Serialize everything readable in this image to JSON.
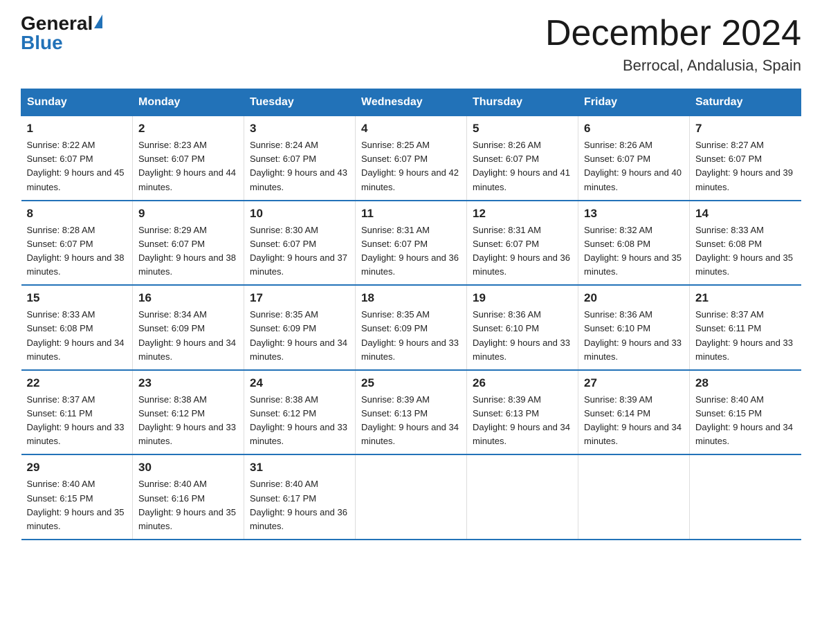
{
  "header": {
    "logo_general": "General",
    "logo_blue": "Blue",
    "month_title": "December 2024",
    "location": "Berrocal, Andalusia, Spain"
  },
  "days_of_week": [
    "Sunday",
    "Monday",
    "Tuesday",
    "Wednesday",
    "Thursday",
    "Friday",
    "Saturday"
  ],
  "weeks": [
    [
      {
        "day": "1",
        "sunrise": "Sunrise: 8:22 AM",
        "sunset": "Sunset: 6:07 PM",
        "daylight": "Daylight: 9 hours and 45 minutes."
      },
      {
        "day": "2",
        "sunrise": "Sunrise: 8:23 AM",
        "sunset": "Sunset: 6:07 PM",
        "daylight": "Daylight: 9 hours and 44 minutes."
      },
      {
        "day": "3",
        "sunrise": "Sunrise: 8:24 AM",
        "sunset": "Sunset: 6:07 PM",
        "daylight": "Daylight: 9 hours and 43 minutes."
      },
      {
        "day": "4",
        "sunrise": "Sunrise: 8:25 AM",
        "sunset": "Sunset: 6:07 PM",
        "daylight": "Daylight: 9 hours and 42 minutes."
      },
      {
        "day": "5",
        "sunrise": "Sunrise: 8:26 AM",
        "sunset": "Sunset: 6:07 PM",
        "daylight": "Daylight: 9 hours and 41 minutes."
      },
      {
        "day": "6",
        "sunrise": "Sunrise: 8:26 AM",
        "sunset": "Sunset: 6:07 PM",
        "daylight": "Daylight: 9 hours and 40 minutes."
      },
      {
        "day": "7",
        "sunrise": "Sunrise: 8:27 AM",
        "sunset": "Sunset: 6:07 PM",
        "daylight": "Daylight: 9 hours and 39 minutes."
      }
    ],
    [
      {
        "day": "8",
        "sunrise": "Sunrise: 8:28 AM",
        "sunset": "Sunset: 6:07 PM",
        "daylight": "Daylight: 9 hours and 38 minutes."
      },
      {
        "day": "9",
        "sunrise": "Sunrise: 8:29 AM",
        "sunset": "Sunset: 6:07 PM",
        "daylight": "Daylight: 9 hours and 38 minutes."
      },
      {
        "day": "10",
        "sunrise": "Sunrise: 8:30 AM",
        "sunset": "Sunset: 6:07 PM",
        "daylight": "Daylight: 9 hours and 37 minutes."
      },
      {
        "day": "11",
        "sunrise": "Sunrise: 8:31 AM",
        "sunset": "Sunset: 6:07 PM",
        "daylight": "Daylight: 9 hours and 36 minutes."
      },
      {
        "day": "12",
        "sunrise": "Sunrise: 8:31 AM",
        "sunset": "Sunset: 6:07 PM",
        "daylight": "Daylight: 9 hours and 36 minutes."
      },
      {
        "day": "13",
        "sunrise": "Sunrise: 8:32 AM",
        "sunset": "Sunset: 6:08 PM",
        "daylight": "Daylight: 9 hours and 35 minutes."
      },
      {
        "day": "14",
        "sunrise": "Sunrise: 8:33 AM",
        "sunset": "Sunset: 6:08 PM",
        "daylight": "Daylight: 9 hours and 35 minutes."
      }
    ],
    [
      {
        "day": "15",
        "sunrise": "Sunrise: 8:33 AM",
        "sunset": "Sunset: 6:08 PM",
        "daylight": "Daylight: 9 hours and 34 minutes."
      },
      {
        "day": "16",
        "sunrise": "Sunrise: 8:34 AM",
        "sunset": "Sunset: 6:09 PM",
        "daylight": "Daylight: 9 hours and 34 minutes."
      },
      {
        "day": "17",
        "sunrise": "Sunrise: 8:35 AM",
        "sunset": "Sunset: 6:09 PM",
        "daylight": "Daylight: 9 hours and 34 minutes."
      },
      {
        "day": "18",
        "sunrise": "Sunrise: 8:35 AM",
        "sunset": "Sunset: 6:09 PM",
        "daylight": "Daylight: 9 hours and 33 minutes."
      },
      {
        "day": "19",
        "sunrise": "Sunrise: 8:36 AM",
        "sunset": "Sunset: 6:10 PM",
        "daylight": "Daylight: 9 hours and 33 minutes."
      },
      {
        "day": "20",
        "sunrise": "Sunrise: 8:36 AM",
        "sunset": "Sunset: 6:10 PM",
        "daylight": "Daylight: 9 hours and 33 minutes."
      },
      {
        "day": "21",
        "sunrise": "Sunrise: 8:37 AM",
        "sunset": "Sunset: 6:11 PM",
        "daylight": "Daylight: 9 hours and 33 minutes."
      }
    ],
    [
      {
        "day": "22",
        "sunrise": "Sunrise: 8:37 AM",
        "sunset": "Sunset: 6:11 PM",
        "daylight": "Daylight: 9 hours and 33 minutes."
      },
      {
        "day": "23",
        "sunrise": "Sunrise: 8:38 AM",
        "sunset": "Sunset: 6:12 PM",
        "daylight": "Daylight: 9 hours and 33 minutes."
      },
      {
        "day": "24",
        "sunrise": "Sunrise: 8:38 AM",
        "sunset": "Sunset: 6:12 PM",
        "daylight": "Daylight: 9 hours and 33 minutes."
      },
      {
        "day": "25",
        "sunrise": "Sunrise: 8:39 AM",
        "sunset": "Sunset: 6:13 PM",
        "daylight": "Daylight: 9 hours and 34 minutes."
      },
      {
        "day": "26",
        "sunrise": "Sunrise: 8:39 AM",
        "sunset": "Sunset: 6:13 PM",
        "daylight": "Daylight: 9 hours and 34 minutes."
      },
      {
        "day": "27",
        "sunrise": "Sunrise: 8:39 AM",
        "sunset": "Sunset: 6:14 PM",
        "daylight": "Daylight: 9 hours and 34 minutes."
      },
      {
        "day": "28",
        "sunrise": "Sunrise: 8:40 AM",
        "sunset": "Sunset: 6:15 PM",
        "daylight": "Daylight: 9 hours and 34 minutes."
      }
    ],
    [
      {
        "day": "29",
        "sunrise": "Sunrise: 8:40 AM",
        "sunset": "Sunset: 6:15 PM",
        "daylight": "Daylight: 9 hours and 35 minutes."
      },
      {
        "day": "30",
        "sunrise": "Sunrise: 8:40 AM",
        "sunset": "Sunset: 6:16 PM",
        "daylight": "Daylight: 9 hours and 35 minutes."
      },
      {
        "day": "31",
        "sunrise": "Sunrise: 8:40 AM",
        "sunset": "Sunset: 6:17 PM",
        "daylight": "Daylight: 9 hours and 36 minutes."
      },
      {
        "day": "",
        "sunrise": "",
        "sunset": "",
        "daylight": ""
      },
      {
        "day": "",
        "sunrise": "",
        "sunset": "",
        "daylight": ""
      },
      {
        "day": "",
        "sunrise": "",
        "sunset": "",
        "daylight": ""
      },
      {
        "day": "",
        "sunrise": "",
        "sunset": "",
        "daylight": ""
      }
    ]
  ]
}
